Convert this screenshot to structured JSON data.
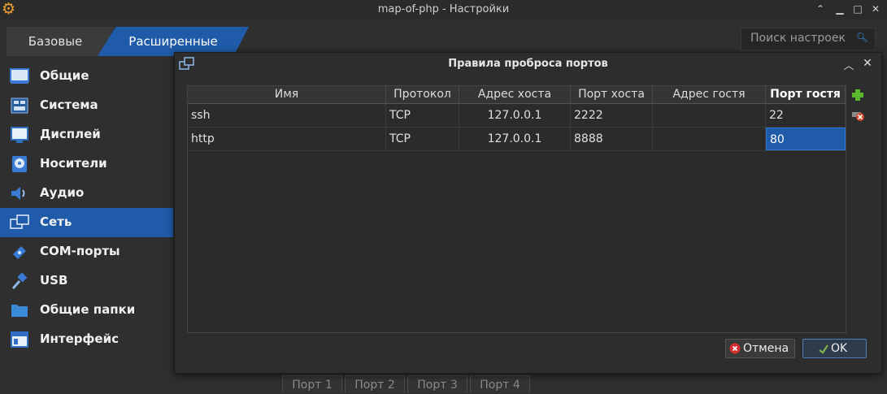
{
  "window": {
    "title": "map-of-php - Настройки",
    "controls": [
      "chevron-up-icon",
      "minimize-icon",
      "maximize-icon",
      "close-icon"
    ]
  },
  "mode_tabs": {
    "basic": "Базовые",
    "advanced": "Расширенные"
  },
  "search": {
    "placeholder": "Поиск настроек"
  },
  "sidebar": {
    "items": [
      {
        "label": "Общие",
        "icon": "general-icon"
      },
      {
        "label": "Система",
        "icon": "system-icon"
      },
      {
        "label": "Дисплей",
        "icon": "display-icon"
      },
      {
        "label": "Носители",
        "icon": "storage-icon"
      },
      {
        "label": "Аудио",
        "icon": "audio-icon"
      },
      {
        "label": "Сеть",
        "icon": "network-icon",
        "active": true
      },
      {
        "label": "COM-порты",
        "icon": "serial-ports-icon"
      },
      {
        "label": "USB",
        "icon": "usb-icon"
      },
      {
        "label": "Общие папки",
        "icon": "shared-folders-icon"
      },
      {
        "label": "Интерфейс",
        "icon": "interface-icon"
      }
    ]
  },
  "port_tabs": [
    "Порт 1",
    "Порт 2",
    "Порт 3",
    "Порт 4"
  ],
  "dialog": {
    "title": "Правила проброса портов",
    "columns": [
      "Имя",
      "Протокол",
      "Адрес хоста",
      "Порт хоста",
      "Адрес гостя",
      "Порт гостя"
    ],
    "rows": [
      {
        "name": "ssh",
        "protocol": "TCP",
        "host_ip": "127.0.0.1",
        "host_port": "2222",
        "guest_ip": "",
        "guest_port": "22"
      },
      {
        "name": "http",
        "protocol": "TCP",
        "host_ip": "127.0.0.1",
        "host_port": "8888",
        "guest_ip": "",
        "guest_port": "80"
      }
    ],
    "cancel_label": "Отмена",
    "ok_label": "OK",
    "accent": "#1f5ba8"
  }
}
